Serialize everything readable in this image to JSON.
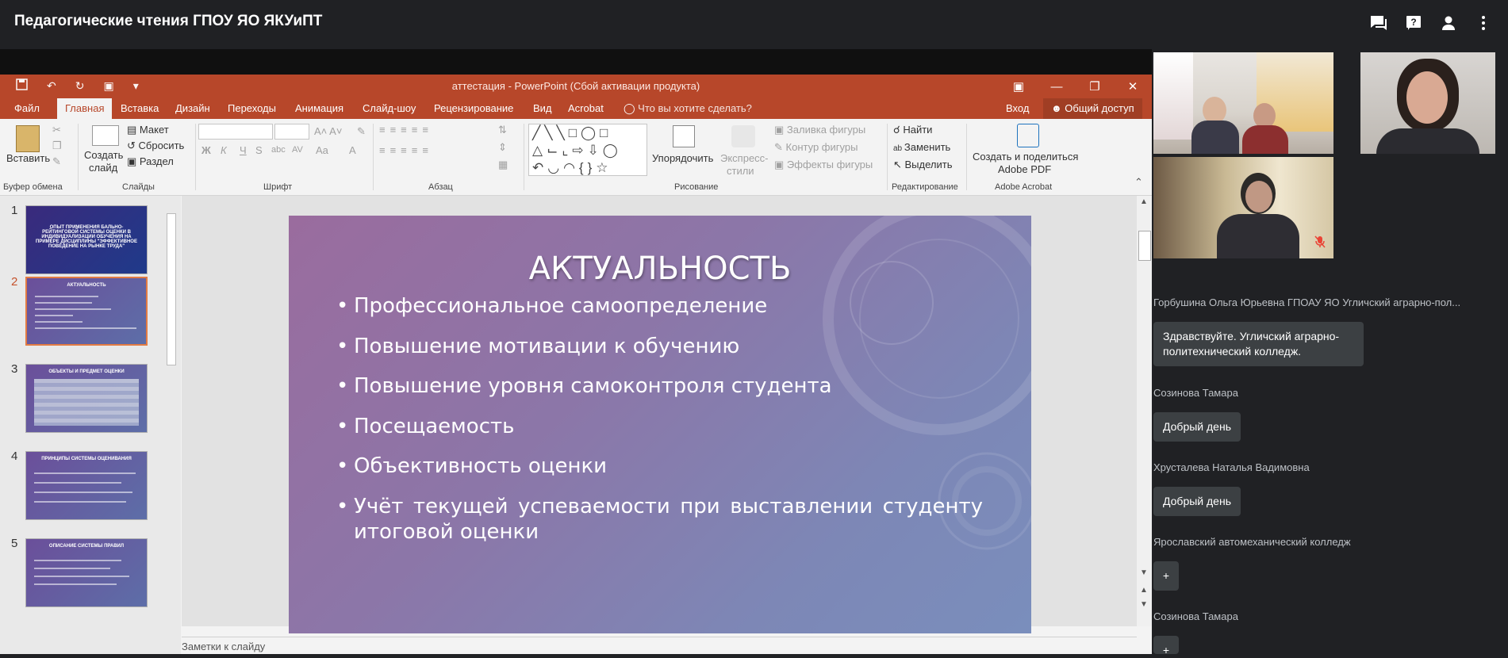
{
  "meet": {
    "title": "Педагогические чтения ГПОУ ЯО ЯКУиПТ",
    "icons": [
      "chat-icon",
      "help-icon",
      "people-icon",
      "more-icon"
    ]
  },
  "powerpoint": {
    "window_title": "аттестация - PowerPoint (Сбой активации продукта)",
    "tabs": [
      "Файл",
      "Главная",
      "Вставка",
      "Дизайн",
      "Переходы",
      "Анимация",
      "Слайд-шоу",
      "Рецензирование",
      "Вид",
      "Acrobat"
    ],
    "active_tab": "Главная",
    "tell_me": "Что вы хотите сделать?",
    "sign_in": "Вход",
    "share": "Общий доступ",
    "ribbon": {
      "paste": "Вставить",
      "new_slide_1": "Создать",
      "new_slide_2": "слайд",
      "layout": "Макет",
      "reset": "Сбросить",
      "section": "Раздел",
      "arrange": "Упорядочить",
      "quick_styles_1": "Экспресс-",
      "quick_styles_2": "стили",
      "shape_fill": "Заливка фигуры",
      "shape_outline": "Контур фигуры",
      "shape_effects": "Эффекты фигуры",
      "find": "Найти",
      "replace": "Заменить",
      "select": "Выделить",
      "create_pdf_1": "Создать и поделиться",
      "create_pdf_2": "Adobe PDF",
      "font_k": "Ж",
      "font_i": "К",
      "font_u": "Ч",
      "font_s": "S",
      "groups": {
        "clipboard": "Буфер обмена",
        "slides": "Слайды",
        "font": "Шрифт",
        "paragraph": "Абзац",
        "drawing": "Рисование",
        "editing": "Редактирование",
        "acrobat": "Adobe Acrobat"
      }
    },
    "thumbnails": [
      {
        "num": "1",
        "title": "ОПЫТ ПРИМЕНЕНИЯ БАЛЬНО-РЕЙТИНГОВОЙ СИСТЕМЫ ОЦЕНКИ В ИНДИВИДУАЛИЗАЦИИ ОБУЧЕНИЯ НА ПРИМЕРЕ ДИСЦИПЛИНЫ \"ЭФФЕКТИВНОЕ ПОВЕДЕНИЕ НА РЫНКЕ ТРУДА\""
      },
      {
        "num": "2",
        "title": "АКТУАЛЬНОСТЬ"
      },
      {
        "num": "3",
        "title": "ОБЪЕКТЫ И ПРЕДМЕТ ОЦЕНКИ"
      },
      {
        "num": "4",
        "title": "ПРИНЦИПЫ СИСТЕМЫ ОЦЕНИВАНИЯ"
      },
      {
        "num": "5",
        "title": "ОПИСАНИЕ СИСТЕМЫ ПРАВИЛ"
      }
    ],
    "slide": {
      "title": "АКТУАЛЬНОСТЬ",
      "bullets": [
        "Профессиональное самоопределение",
        "Повышение мотивации к обучению",
        "Повышение уровня самоконтроля студента",
        "Посещаемость",
        "Объективность оценки",
        "Учёт текущей успеваемости при выставлении студенту итоговой оценки"
      ]
    },
    "notes": "Заметки к слайду"
  },
  "chat": [
    {
      "sender": "Горбушина Ольга Юрьевна ГПОАУ ЯО Угличский аграрно-пол...",
      "message": "Здравствуйте. Угличский аграрно-политехнический колледж."
    },
    {
      "sender": "Созинова Тамара",
      "message": "Добрый день"
    },
    {
      "sender": "Хрусталева Наталья Вадимовна",
      "message": "Добрый день"
    },
    {
      "sender": "Ярославский автомеханический колледж",
      "message": "+"
    },
    {
      "sender": "Созинова Тамара",
      "message": "+"
    }
  ],
  "colors": {
    "ppt_accent": "#b7472a",
    "meet_bg": "#202124",
    "bubble": "#3c4043"
  }
}
